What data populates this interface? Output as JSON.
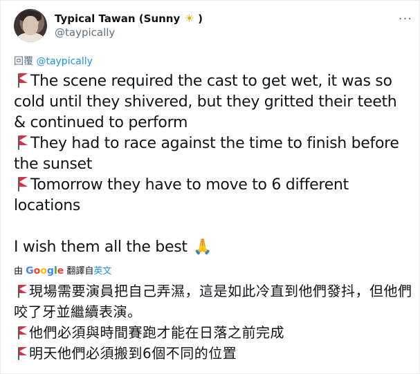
{
  "author": {
    "display_name": "Typical Tawan (Sunny",
    "sun": "☀",
    "close_paren": ")",
    "handle": "@taypically"
  },
  "reply": {
    "prefix": "回覆",
    "mention": "@taypically"
  },
  "tweet": {
    "line1": "The scene required the cast to get wet, it was so cold until they shivered, but they gritted their teeth & continued to perform",
    "line2": "They had to race against the time to finish before the sunset",
    "line3": "Tomorrow they have to move to 6 different locations",
    "closing": "I wish them all the best",
    "closing_emoji": "🙏"
  },
  "translation": {
    "by": "由",
    "google_letters": [
      "G",
      "o",
      "o",
      "g",
      "l",
      "e"
    ],
    "translated_from": "翻譯自",
    "source_language": "英文"
  },
  "translated": {
    "line1": "現場需要演員把自己弄濕，這是如此冷直到他們發抖，但他們咬了牙並繼續表演。",
    "line2": "他們必須與時間賽跑才能在日落之前完成",
    "line3": "明天他們必須搬到6個不同的位置"
  },
  "colors": {
    "link": "#1b95e0",
    "secondary_text": "#5b7083",
    "flag_red": "#dd2e44"
  },
  "icons": {
    "more": "more-options-icon",
    "flag": "triangular-flag-icon",
    "prayer": "folded-hands-icon"
  }
}
